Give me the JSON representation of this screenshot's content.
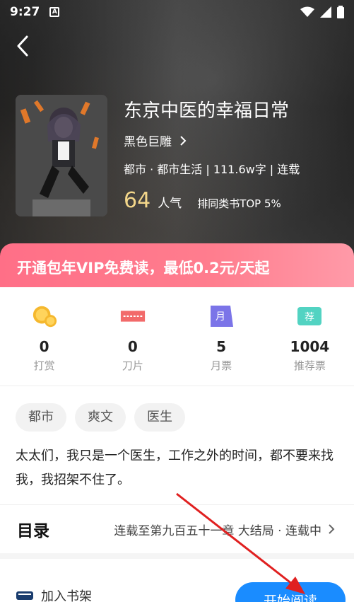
{
  "status_bar": {
    "time": "9:27",
    "notification_badge": "A"
  },
  "book": {
    "title": "东京中医的幸福日常",
    "author": "黑色巨雕",
    "meta": "都市 · 都市生活 | 111.6w字 | 连载",
    "popularity_value": "64",
    "popularity_label": "人气",
    "rank_text": "排同类书TOP 5%"
  },
  "vip_banner": {
    "text": "开通包年VIP免费读，最低0.2元/天起"
  },
  "stats": [
    {
      "value": "0",
      "label": "打赏",
      "icon": "coin-icon"
    },
    {
      "value": "0",
      "label": "刀片",
      "icon": "blade-icon"
    },
    {
      "value": "5",
      "label": "月票",
      "icon": "monthly-ticket-icon"
    },
    {
      "value": "1004",
      "label": "推荐票",
      "icon": "recommend-ticket-icon"
    }
  ],
  "stat_icon_text": {
    "monthly": "月",
    "recommend": "荐"
  },
  "tags": [
    "都市",
    "爽文",
    "医生"
  ],
  "description": "太太们，我只是一个医生，工作之外的时间，都不要来找我，我招架不住了。",
  "toc": {
    "title": "目录",
    "info": "连载至第九百五十一章 大结局 · 连载中"
  },
  "bottom_bar": {
    "shelf_label": "加入书架",
    "start_label": "开始阅读"
  },
  "colors": {
    "vip_gradient_start": "#ff6f87",
    "popularity": "#f3d68a",
    "start_button": "#1a8cff",
    "annotation_arrow": "#e02020"
  }
}
